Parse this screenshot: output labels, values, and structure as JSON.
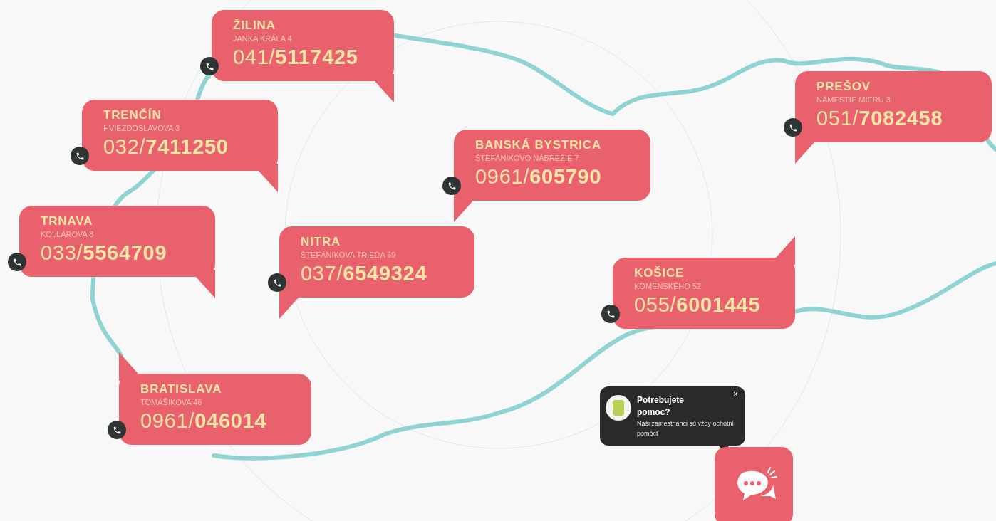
{
  "offices": [
    {
      "city": "ŽILINA",
      "address": "JANKA KRÁĽA 4",
      "phone": "041/**5117425**",
      "kind": "southeast"
    },
    {
      "city": "TRENČÍN",
      "address": "HVIEZDOSLAVOVA 3",
      "phone": "032/**7411250**",
      "kind": "southeast"
    },
    {
      "city": "BANSKÁ BYSTRICA",
      "address": "ŠTEFÁNIKOVO NÁBREŽIE 7",
      "phone": "0961/**605790**",
      "kind": "southwest"
    },
    {
      "city": "PREŠOV",
      "address": "NÁMESTIE MIERU 3",
      "phone": "051/**7082458**",
      "kind": "southwest"
    },
    {
      "city": "TRNAVA",
      "address": "KOLLÁROVA 8",
      "phone": "033/**5564709**",
      "kind": "southeast"
    },
    {
      "city": "NITRA",
      "address": "ŠTEFÁNIKOVA TRIEDA 69",
      "phone": "037/**6549324**",
      "kind": "southwest"
    },
    {
      "city": "KOŠICE",
      "address": "KOMENSKÉHO 52",
      "phone": "055/**6001445**",
      "kind": "northeast"
    },
    {
      "city": "BRATISLAVA",
      "address": "TOMÁŠIKOVA 46",
      "phone": "0961/**046014**",
      "kind": "northwest"
    }
  ],
  "chat_popup": {
    "title": "Potrebujete pomoc?",
    "message": "Naši zamestnanci sú vždy ochotní pomôcť",
    "close": "×"
  }
}
